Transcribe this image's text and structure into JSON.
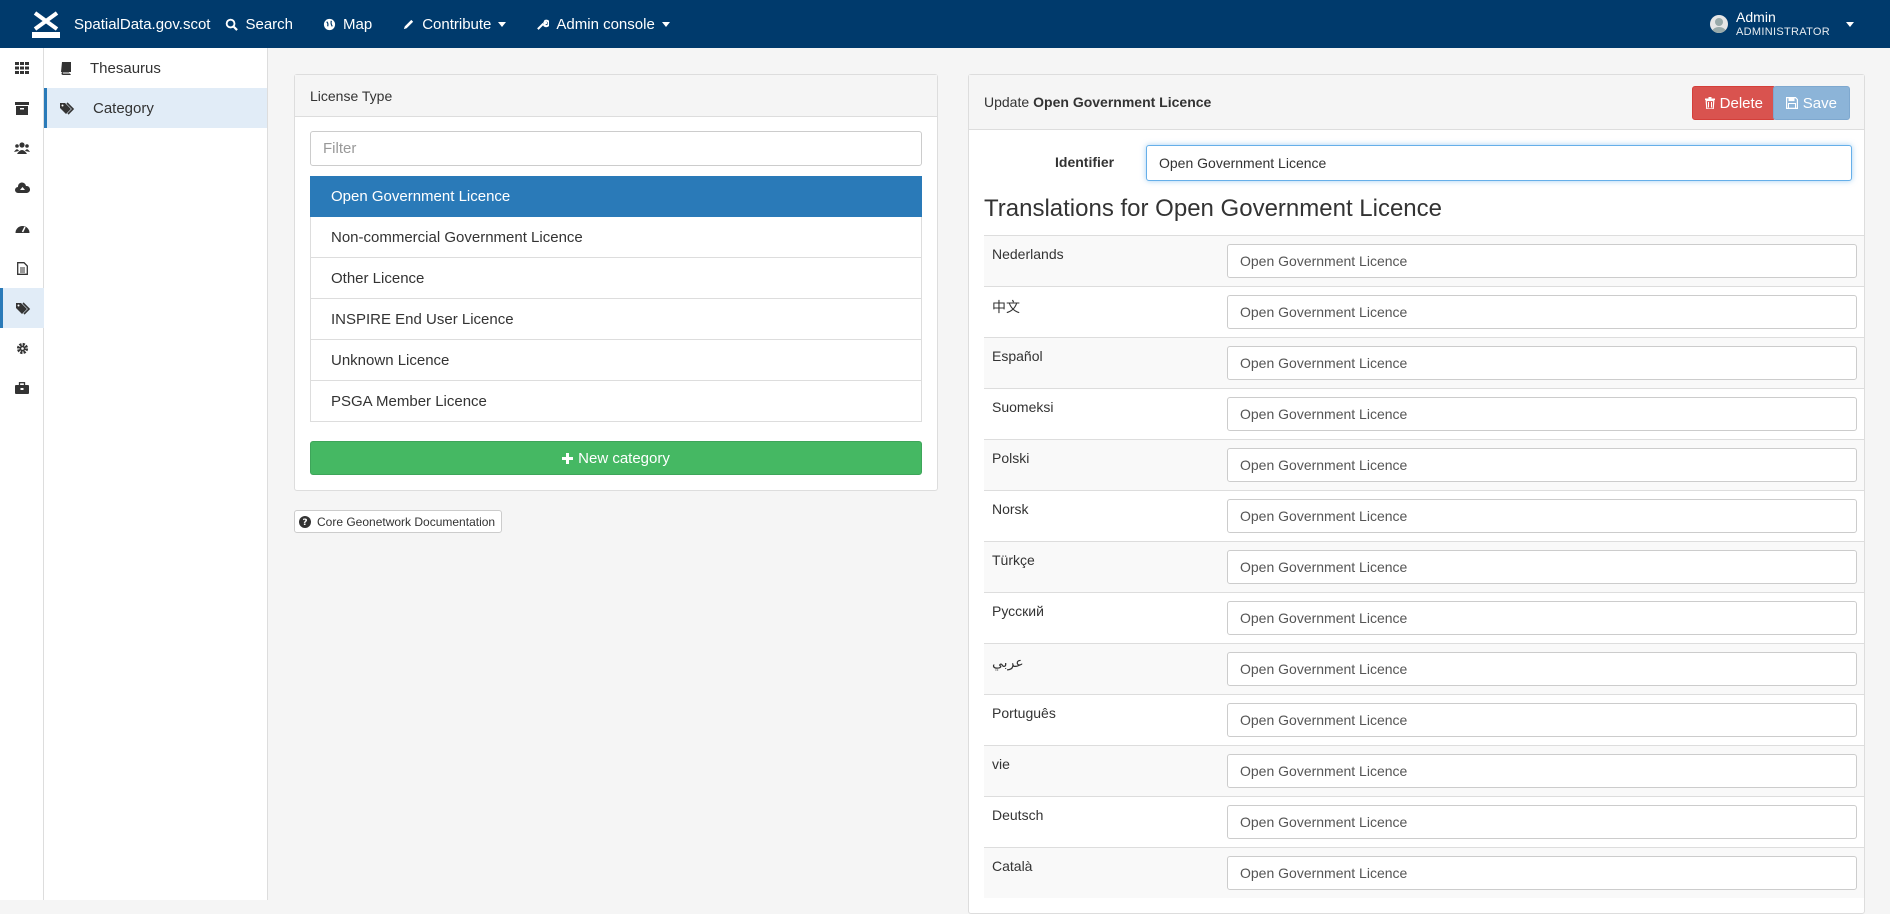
{
  "topbar": {
    "brand": "SpatialData.gov.scot",
    "logo_text": "gov.scot",
    "nav": [
      {
        "label": "Search",
        "icon": "search-icon"
      },
      {
        "label": "Map",
        "icon": "globe-icon"
      },
      {
        "label": "Contribute",
        "icon": "pencil-icon"
      },
      {
        "label": "Admin console",
        "icon": "wrench-icon"
      }
    ],
    "user": {
      "name": "Admin",
      "role": "ADMINISTRATOR"
    }
  },
  "rail": {
    "icons": [
      "grid-icon",
      "archive-icon",
      "users-icon",
      "cloud-upload-icon",
      "dashboard-icon",
      "file-icon",
      "tags-icon",
      "gear-icon",
      "briefcase-icon"
    ],
    "active_index": 6
  },
  "sidenav": {
    "items": [
      {
        "label": "Thesaurus",
        "icon": "book-icon"
      },
      {
        "label": "Category",
        "icon": "tags-icon"
      }
    ]
  },
  "left_panel": {
    "title": "License Type",
    "filter_placeholder": "Filter",
    "items": [
      "Open Government Licence",
      "Non-commercial Government Licence",
      "Other Licence",
      "INSPIRE End User Licence",
      "Unknown Licence",
      "PSGA Member Licence"
    ],
    "new_button": "New category"
  },
  "doc_button": "Core Geonetwork Documentation",
  "right_panel": {
    "title_prefix": "Update",
    "title_name": "Open Government Licence",
    "delete_label": "Delete",
    "save_label": "Save",
    "identifier_label": "Identifier",
    "identifier_value": "Open Government Licence",
    "translations_title": "Translations for Open Government Licence",
    "translations": [
      {
        "lang": "Nederlands",
        "value": "Open Government Licence"
      },
      {
        "lang": "中文",
        "value": "Open Government Licence"
      },
      {
        "lang": "Español",
        "value": "Open Government Licence"
      },
      {
        "lang": "Suomeksi",
        "value": "Open Government Licence"
      },
      {
        "lang": "Polski",
        "value": "Open Government Licence"
      },
      {
        "lang": "Norsk",
        "value": "Open Government Licence"
      },
      {
        "lang": "Türkçe",
        "value": "Open Government Licence"
      },
      {
        "lang": "Русский",
        "value": "Open Government Licence"
      },
      {
        "lang": "عربي",
        "value": "Open Government Licence"
      },
      {
        "lang": "Português",
        "value": "Open Government Licence"
      },
      {
        "lang": "vie",
        "value": "Open Government Licence"
      },
      {
        "lang": "Deutsch",
        "value": "Open Government Licence"
      },
      {
        "lang": "Català",
        "value": "Open Government Licence"
      }
    ]
  },
  "colors": {
    "navbar": "#003a6c",
    "active": "#2a7ab8",
    "success": "#45b863",
    "danger": "#d9534f",
    "save": "#8cb4d8"
  }
}
